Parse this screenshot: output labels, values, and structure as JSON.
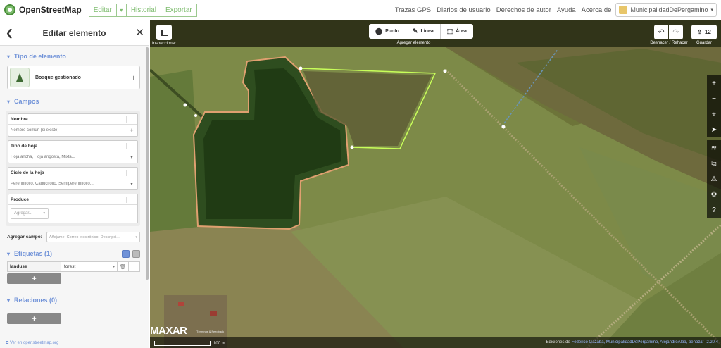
{
  "app": {
    "name": "OpenStreetMap",
    "edit_label": "Editar",
    "history_label": "Historial",
    "export_label": "Exportar"
  },
  "topnav": {
    "links": [
      "Trazas GPS",
      "Diarios de usuario",
      "Derechos de autor",
      "Ayuda",
      "Acerca de"
    ],
    "user": "MunicipalidadDePergamino"
  },
  "sidebar": {
    "title": "Editar elemento",
    "type_section": "Tipo de elemento",
    "preset_label": "Bosque gestionado",
    "fields_section": "Campos",
    "fields": [
      {
        "label": "Nombre",
        "placeholder": "Nombre común (si existe)"
      },
      {
        "label": "Tipo de hoja",
        "placeholder": "Hoja ancha, Hoja angosta, Mixta..."
      },
      {
        "label": "Ciclo de la hoja",
        "placeholder": "Perennifolio, Caducifolio, Semiperennifolio..."
      }
    ],
    "produce": {
      "label": "Produce",
      "placeholder": "Agregar..."
    },
    "add_field": {
      "label": "Agregar campo:",
      "placeholder": "Añejame, Correo electrónico, Descripci..."
    },
    "tags_section": "Etiquetas (1)",
    "tag": {
      "key": "landuse",
      "value": "forest"
    },
    "relations_section": "Relaciones (0)",
    "add_symbol": "+",
    "footer_link": "Ver en openstreetmap.org"
  },
  "map": {
    "inspect_label": "Inspeccionar",
    "modes": [
      "Punto",
      "Línea",
      "Área"
    ],
    "add_element_label": "Agregar elemento",
    "undo_redo_label": "Deshacer / Rehacer",
    "save_label": "Guardar",
    "save_count": "12",
    "imagery": "MAXAR",
    "imagery_credit": "Términos & Feedback",
    "scale_label": "100 m",
    "edits_prefix": "Ediciones de",
    "edits_names": "Federico Gazaba, MunicipalidadDePergamino, AlejandroAlba, benozaf",
    "version": "2.20.4"
  },
  "colors": {
    "accent": "#7ebc6f",
    "link": "#7092d8",
    "area_outline": "#e0a070",
    "selected_line": "#c8ff5a"
  }
}
